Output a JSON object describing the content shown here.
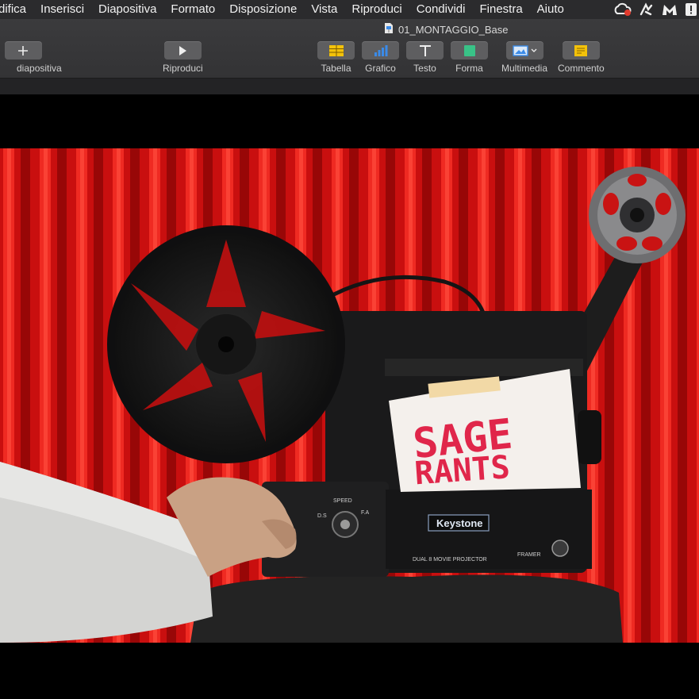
{
  "menubar": {
    "items": [
      "difica",
      "Inserisci",
      "Diapositiva",
      "Formato",
      "Disposizione",
      "Vista",
      "Riproduci",
      "Condividi",
      "Finestra",
      "Aiuto"
    ],
    "status_icons": [
      "creative-cloud-icon",
      "script-icon",
      "malwarebytes-icon",
      "alert-icon"
    ]
  },
  "document": {
    "title": "01_MONTAGGIO_Base",
    "icon": "keynote-document-icon"
  },
  "toolbar": {
    "add_slide_label": "diapositiva",
    "play_label": "Riproduci",
    "table_label": "Tabella",
    "chart_label": "Grafico",
    "text_label": "Testo",
    "shape_label": "Forma",
    "media_label": "Multimedia",
    "comment_label": "Commento"
  },
  "colors": {
    "menubar_bg": "#2b2b2d",
    "toolbar_bg": "#3b3b3d",
    "curtain_red": "#d51313",
    "table_icon": "#f3c20a",
    "chart_icon": "#3b8be8",
    "shape_icon": "#39c287",
    "comment_icon": "#f3c20a"
  },
  "slide": {
    "sign_line1": "SAGE",
    "sign_line2": "RANTS",
    "brand": "Keystone",
    "speed_label": "SPEED",
    "speed_marks": [
      "D.S",
      "F.A"
    ],
    "framer_label": "FRAMER",
    "model_label": "DUAL 8 MOVIE PROJECTOR"
  }
}
